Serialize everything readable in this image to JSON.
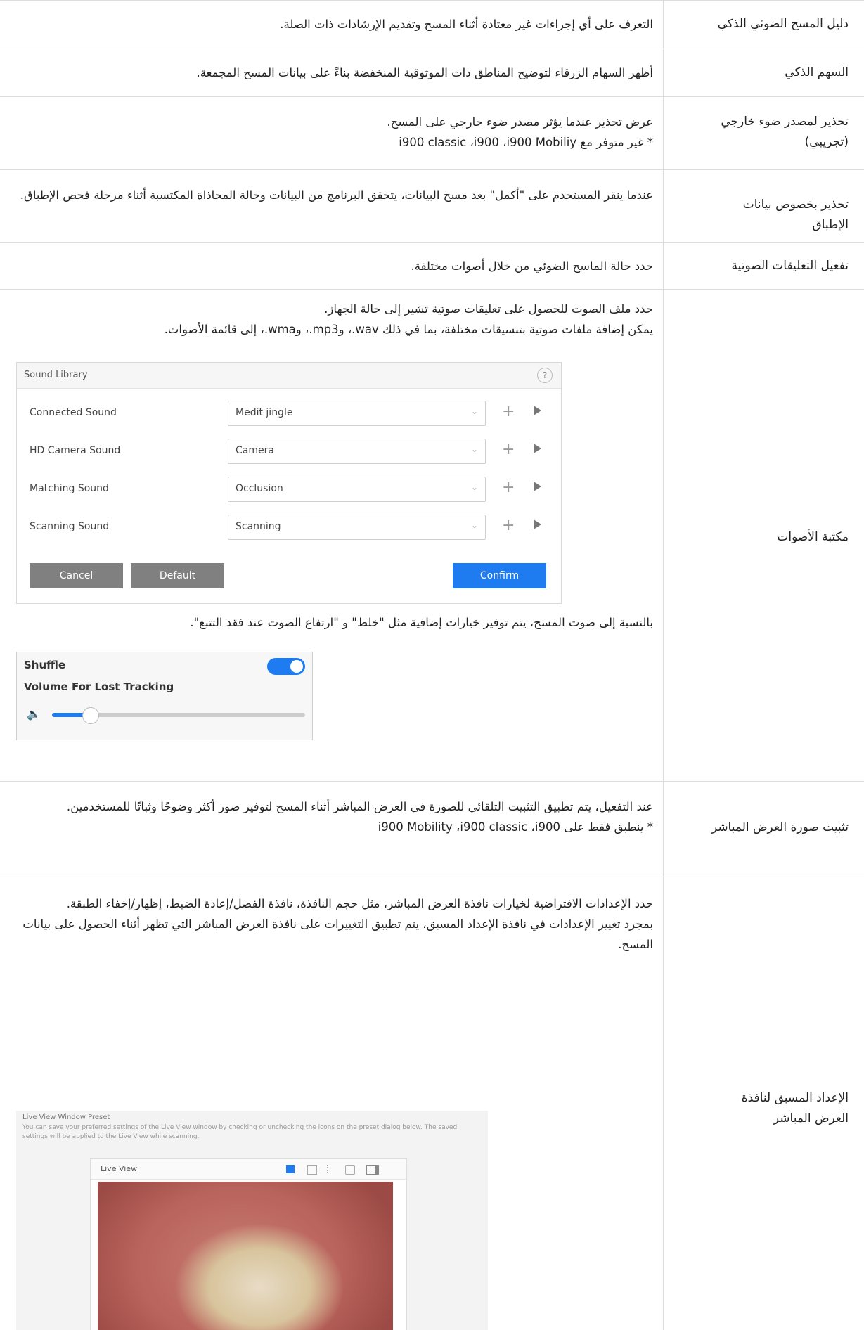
{
  "rows": [
    {
      "label": "دليل المسح الضوئي الذكي",
      "desc": "التعرف على أي إجراءات غير معتادة أثناء المسح وتقديم الإرشادات ذات الصلة."
    },
    {
      "label": "السهم الذكي",
      "desc": "أظهر السهام الزرقاء لتوضيح المناطق ذات الموثوقية المنخفضة بناءً على بيانات المسح المجمعة."
    },
    {
      "label": "تحذير لمصدر ضوء خارجي (تجريبي)",
      "desc": "عرض تحذير عندما يؤثر مصدر ضوء خارجي على المسح.",
      "desc2": "* غير متوفر مع i900 classic ،i900 ،i900 Mobiliy"
    },
    {
      "label": "تحذير بخصوص بيانات الإطباق",
      "desc": "عندما ينقر المستخدم على \"أكمل\" بعد مسح البيانات، يتحقق البرنامج من البيانات وحالة المحاذاة المكتسبة أثناء مرحلة فحص الإطباق."
    },
    {
      "label": "تفعيل التعليقات الصوتية",
      "desc": "حدد حالة الماسح الضوئي من خلال أصوات مختلفة."
    },
    {
      "label": "مكتبة الأصوات",
      "desc": "حدد ملف الصوت للحصول على تعليقات صوتية تشير إلى حالة الجهاز.",
      "desc2": "يمكن إضافة ملفات صوتية بتنسيقات مختلفة، بما في ذلك wav.، وmp3.، وwma.، إلى قائمة الأصوات.",
      "desc3": "بالنسبة إلى صوت المسح، يتم توفير خيارات إضافية مثل \"خلط\" و \"ارتفاع الصوت عند فقد التتبع\"."
    },
    {
      "label": "تثبيت صورة العرض المباشر",
      "desc": "عند التفعيل، يتم تطبيق التثبيت التلقائي للصورة في العرض المباشر أثناء المسح لتوفير صور أكثر وضوحًا وثباتًا للمستخدمين.",
      "desc2": "* ينطبق فقط على i900 Mobility ،i900 classic ،i900"
    },
    {
      "label": "الإعداد المسبق لنافذة العرض المباشر",
      "desc": "حدد الإعدادات الافتراضية لخيارات نافذة العرض المباشر، مثل حجم النافذة، نافذة الفصل/إعادة الضبط، إظهار/إخفاء الطبقة.",
      "desc2": "بمجرد تغيير الإعدادات في نافذة الإعداد المسبق، يتم تطبيق التغييرات على نافذة العرض المباشر التي تظهر أثناء الحصول على بيانات المسح."
    }
  ],
  "sound_library": {
    "title": "Sound Library",
    "help": "?",
    "items": [
      {
        "name": "Connected Sound",
        "value": "Medit jingle"
      },
      {
        "name": "HD Camera Sound",
        "value": "Camera"
      },
      {
        "name": "Matching Sound",
        "value": "Occlusion"
      },
      {
        "name": "Scanning Sound",
        "value": "Scanning"
      }
    ],
    "cancel": "Cancel",
    "default": "Default",
    "confirm": "Confirm"
  },
  "shuffle_panel": {
    "shuffle": "Shuffle",
    "shuffle_on": true,
    "volume_label": "Volume For Lost Tracking",
    "volume_level": 0.15
  },
  "live_view": {
    "title": "Live View Window Preset",
    "note": "You can save your preferred settings of the Live View window by checking or unchecking the icons on the preset dialog below. The saved settings will be applied to the Live View while scanning.",
    "window_title": "Live View"
  },
  "colors": {
    "accent": "#1f7bf0",
    "button_gray": "#808080",
    "border": "#dcdcdc"
  }
}
